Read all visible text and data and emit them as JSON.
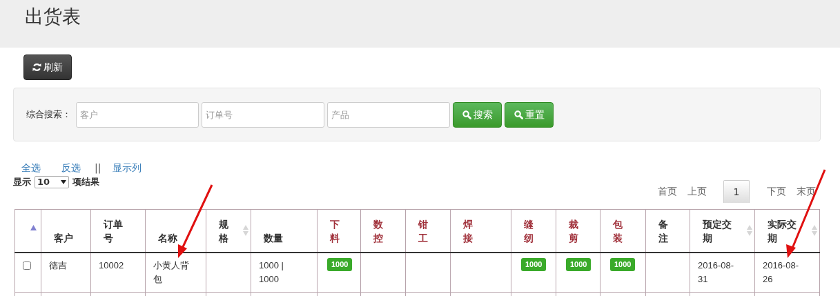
{
  "page_title": "出货表",
  "refresh_button": {
    "label": "刷新"
  },
  "search": {
    "label": "综合搜索：",
    "fields": [
      {
        "placeholder": "客户"
      },
      {
        "placeholder": "订单号"
      },
      {
        "placeholder": "产品"
      }
    ],
    "buttons": [
      {
        "label": "搜索"
      },
      {
        "label": "重置"
      }
    ]
  },
  "links": [
    {
      "kind": "link",
      "label": "全选"
    },
    {
      "kind": "link",
      "label": "反选"
    },
    {
      "kind": "separator",
      "label": "||"
    },
    {
      "kind": "link",
      "label": "显示列"
    }
  ],
  "page_length": {
    "prefix": "显示",
    "value": "10",
    "suffix": "项结果"
  },
  "pagination": [
    {
      "label": "首页",
      "selected": false
    },
    {
      "label": "上页",
      "selected": false
    },
    {
      "label": "1",
      "selected": true
    },
    {
      "label": "下页",
      "selected": false
    },
    {
      "label": "末页",
      "selected": false
    }
  ],
  "table": {
    "columns": [
      {
        "kind": "select",
        "sorted_ascending": true
      },
      {
        "kind": "plain",
        "label": "客户"
      },
      {
        "kind": "plain",
        "label": "订单号"
      },
      {
        "kind": "plain",
        "label": "名称"
      },
      {
        "kind": "plain",
        "label": "规格",
        "sortable": true
      },
      {
        "kind": "plain",
        "label": "数量"
      },
      {
        "kind": "process",
        "label": "下料"
      },
      {
        "kind": "process",
        "label": "数控"
      },
      {
        "kind": "process",
        "label": "钳工"
      },
      {
        "kind": "process",
        "label": "焊接"
      },
      {
        "kind": "process",
        "label": "缝纫"
      },
      {
        "kind": "process",
        "label": "裁剪"
      },
      {
        "kind": "process",
        "label": "包装"
      },
      {
        "kind": "plain",
        "label": "备注"
      },
      {
        "kind": "plain",
        "label": "预定交期",
        "sortable": true
      },
      {
        "kind": "plain",
        "label": "实际交期",
        "sortable": true
      }
    ],
    "rows": [
      {
        "cells": [
          {
            "kind": "checkbox",
            "checked": false
          },
          {
            "kind": "text",
            "text": "德吉"
          },
          {
            "kind": "text",
            "text": "10002"
          },
          {
            "kind": "text",
            "text": "小黄人背包"
          },
          {
            "kind": "empty"
          },
          {
            "kind": "text",
            "text": "1000 | 1000"
          },
          {
            "kind": "badge",
            "text": "1000"
          },
          {
            "kind": "empty"
          },
          {
            "kind": "empty"
          },
          {
            "kind": "empty"
          },
          {
            "kind": "badge",
            "text": "1000"
          },
          {
            "kind": "badge",
            "text": "1000"
          },
          {
            "kind": "badge",
            "text": "1000"
          },
          {
            "kind": "empty"
          },
          {
            "kind": "text",
            "text": "2016-08-31"
          },
          {
            "kind": "text",
            "text": "2016-08-26"
          }
        ]
      }
    ]
  }
}
